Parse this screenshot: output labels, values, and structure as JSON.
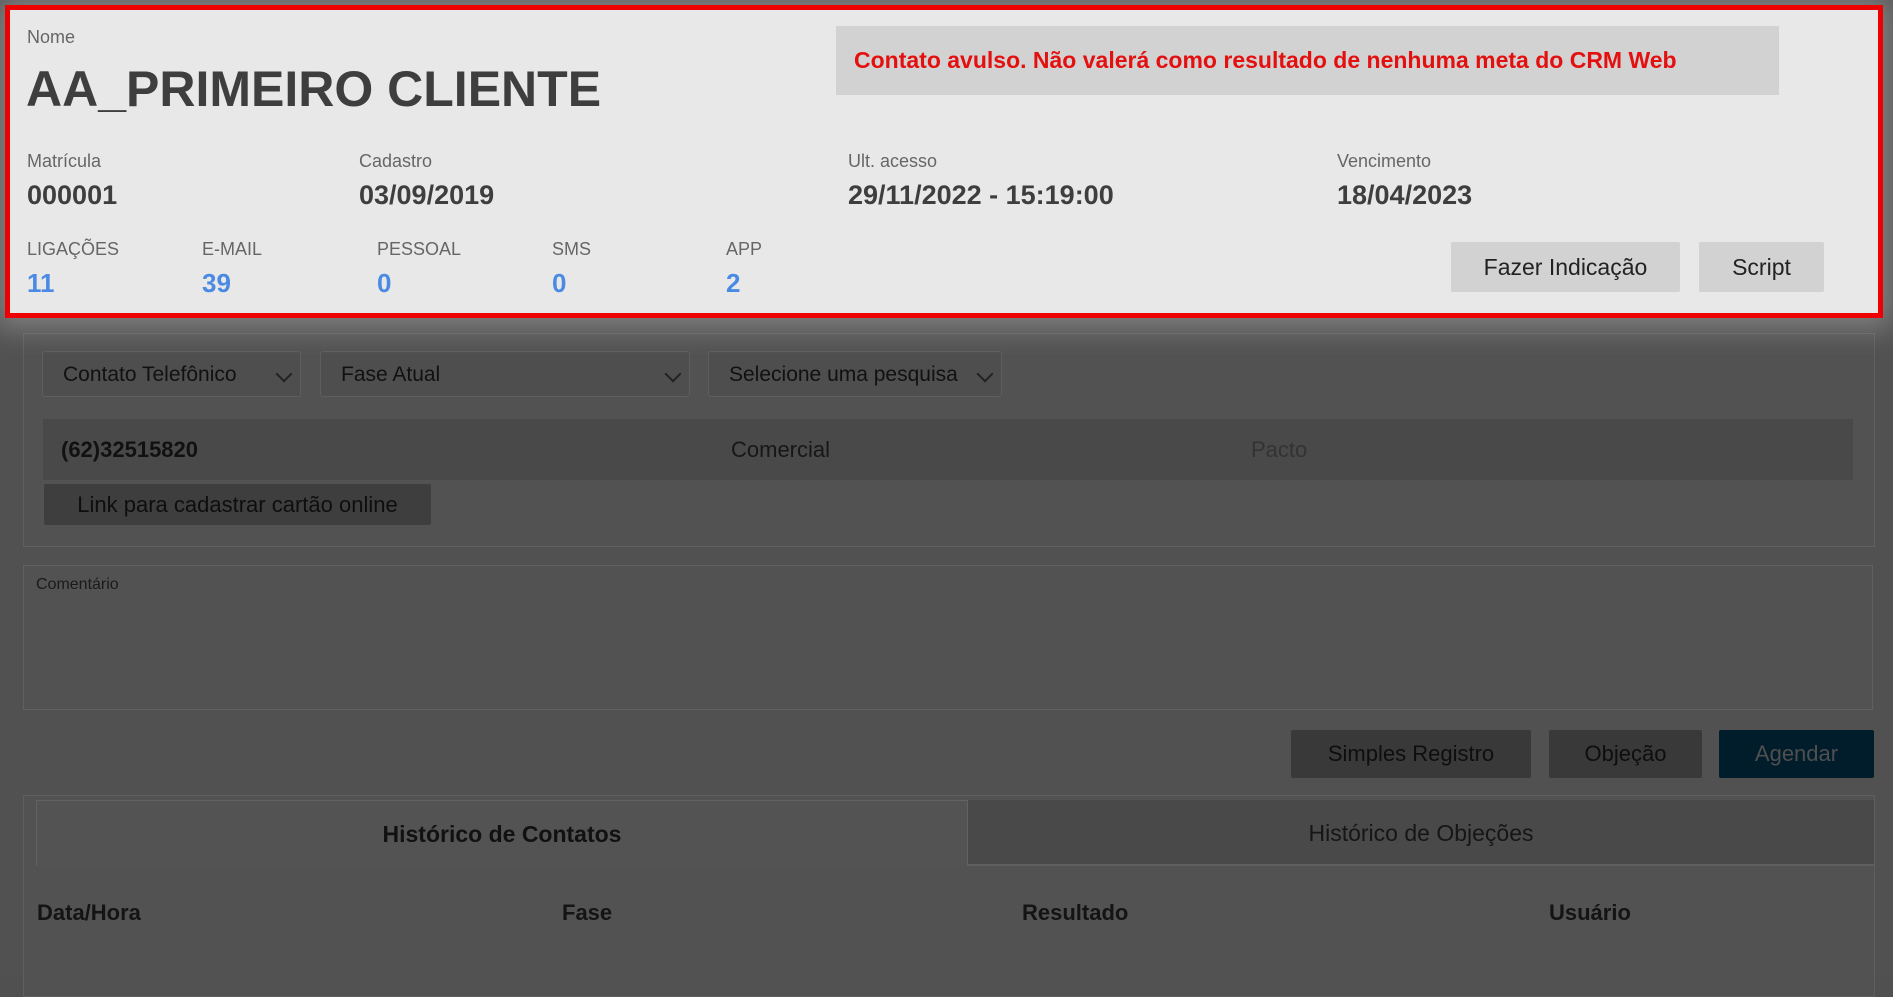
{
  "header": {
    "nome_label": "Nome",
    "client_name": "AA_PRIMEIRO CLIENTE",
    "alert_text": "Contato avulso. Não valerá como resultado de nenhuma meta do CRM Web",
    "info": [
      {
        "label": "Matrícula",
        "value": "000001"
      },
      {
        "label": "Cadastro",
        "value": "03/09/2019"
      },
      {
        "label": "Ult. acesso",
        "value": "29/11/2022 - 15:19:00"
      },
      {
        "label": "Vencimento",
        "value": "18/04/2023"
      }
    ],
    "stats": [
      {
        "label": "LIGAÇÕES",
        "value": "11"
      },
      {
        "label": "E-MAIL",
        "value": "39"
      },
      {
        "label": "PESSOAL",
        "value": "0"
      },
      {
        "label": "SMS",
        "value": "0"
      },
      {
        "label": "APP",
        "value": "2"
      }
    ],
    "buttons": {
      "indicacao": "Fazer Indicação",
      "script": "Script"
    },
    "highlight_color": "#ee0000",
    "stat_color": "#4a8ae4"
  },
  "contact": {
    "selects": {
      "type": "Contato Telefônico",
      "phase": "Fase Atual",
      "survey": "Selecione uma pesquisa"
    },
    "phone": {
      "number": "(62)32515820",
      "kind": "Comercial",
      "place": "Pacto"
    },
    "card_link_button": "Link para cadastrar cartão online"
  },
  "comment": {
    "label": "Comentário",
    "value": ""
  },
  "actions": {
    "simples": "Simples Registro",
    "objecao": "Objeção",
    "agendar": "Agendar",
    "agendar_color": "#011c2b"
  },
  "history": {
    "tabs": [
      "Histórico de Contatos",
      "Histórico de Objeções"
    ],
    "columns": [
      "Data/Hora",
      "Fase",
      "Resultado",
      "Usuário"
    ]
  }
}
